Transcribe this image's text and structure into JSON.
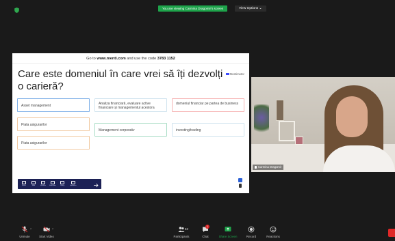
{
  "topbar": {
    "sharing_banner": "You are viewing Carmina Dragomir's screen",
    "view_options": "View Options ⌄"
  },
  "shared_screen": {
    "goto_prefix": "Go to",
    "goto_site": "www.menti.com",
    "goto_middle": "and use the code",
    "goto_code": "3783 1152",
    "question": "Care este domeniul în care vrei să îți dezvolți o carieră?",
    "brand": "Mentimeter",
    "options": [
      "Asset management",
      "Piata asigurarilor",
      "Piata asigurarilor",
      "Analiza financiară, evaluare active financiare și managementul acestora",
      "Management corporativ",
      "domeniul financiar pe partea de business",
      "investing/trading"
    ],
    "toolbar_items": [
      "Menu",
      "Hide",
      "Markers",
      "Reactions",
      "Voting",
      "Audience"
    ]
  },
  "participant": {
    "name": "Carmina Dragomir"
  },
  "bottombar": {
    "unmute": "Unmute",
    "start_video": "Start Video",
    "participants": "Participants",
    "participants_count": "62",
    "chat": "Chat",
    "chat_badge": "1",
    "share_screen": "Share Screen",
    "record": "Record",
    "reactions": "Reactions"
  },
  "colors": {
    "sharing_green": "#1ea44b",
    "share_screen_green": "#1ea44b",
    "end_red": "#e02828",
    "menti_toolbar": "#1c2155"
  }
}
